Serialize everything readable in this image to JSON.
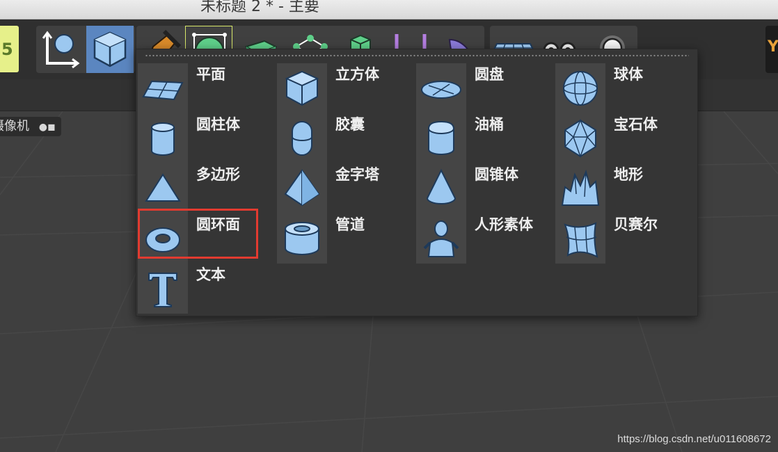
{
  "window": {
    "title": "未标题 2 * - 主要"
  },
  "toolbar": {
    "logo_icon": "cinema4d-logo-icon",
    "buttons": [
      {
        "name": "coordinate-axis-icon"
      },
      {
        "name": "cube-object-icon",
        "state": "active"
      },
      {
        "name": "pen-spline-icon"
      },
      {
        "name": "subdivision-surface-icon",
        "state": "selected"
      },
      {
        "name": "extrude-generator-icon"
      },
      {
        "name": "mograph-cloner-icon"
      },
      {
        "name": "array-cube-icon"
      },
      {
        "name": "deformer-icon"
      },
      {
        "name": "bend-object-icon"
      },
      {
        "name": "floor-plane-icon"
      },
      {
        "name": "camera-icon"
      },
      {
        "name": "light-bulb-icon"
      }
    ],
    "right_icon": "render-settings-icon"
  },
  "viewport": {
    "camera_label": "摄像机",
    "camera_icon": "camera-icon"
  },
  "popup": {
    "columns": [
      [
        {
          "label": "平面",
          "icon": "plane-icon"
        },
        {
          "label": "圆柱体",
          "icon": "cylinder-icon"
        },
        {
          "label": "多边形",
          "icon": "polygon-icon"
        },
        {
          "label": "圆环面",
          "icon": "torus-icon",
          "highlighted": true
        },
        {
          "label": "文本",
          "icon": "text-icon"
        }
      ],
      [
        {
          "label": "立方体",
          "icon": "cube-icon"
        },
        {
          "label": "胶囊",
          "icon": "capsule-icon"
        },
        {
          "label": "金字塔",
          "icon": "pyramid-icon"
        },
        {
          "label": "管道",
          "icon": "tube-icon"
        }
      ],
      [
        {
          "label": "圆盘",
          "icon": "disc-icon"
        },
        {
          "label": "油桶",
          "icon": "oil-tank-icon"
        },
        {
          "label": "圆锥体",
          "icon": "cone-icon"
        },
        {
          "label": "人形素体",
          "icon": "figure-icon"
        }
      ],
      [
        {
          "label": "球体",
          "icon": "sphere-icon"
        },
        {
          "label": "宝石体",
          "icon": "platonic-icon"
        },
        {
          "label": "地形",
          "icon": "landscape-icon"
        },
        {
          "label": "贝赛尔",
          "icon": "bezier-icon"
        }
      ]
    ]
  },
  "annotation": {
    "highlight_color": "#e23b30"
  },
  "watermark": "https://blog.csdn.net/u011608672",
  "colors": {
    "icon_fill": "#9cc8f0",
    "icon_outline": "#1e3a5a",
    "active_button": "#5b86c0",
    "popup_bg": "#353535"
  }
}
